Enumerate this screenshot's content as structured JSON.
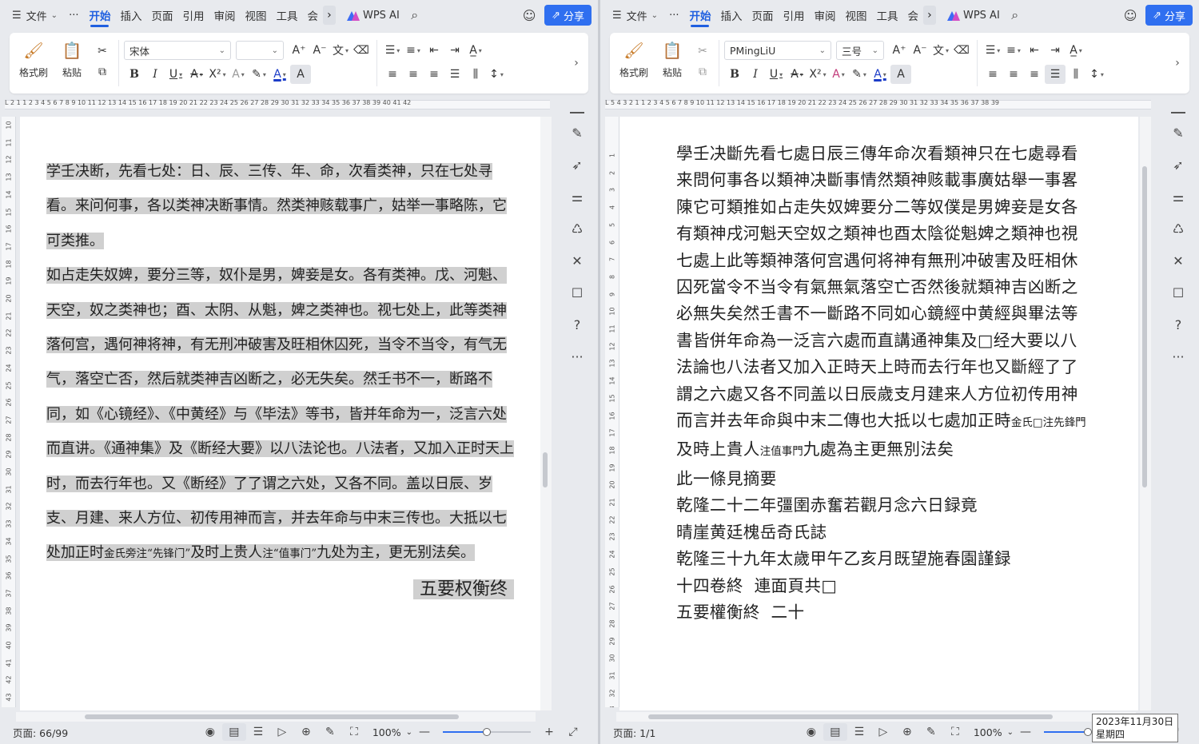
{
  "menubar": {
    "file_label": "文件",
    "more_label": "···",
    "tabs": [
      "开始",
      "插入",
      "页面",
      "引用",
      "审阅",
      "视图",
      "工具",
      "会"
    ],
    "wps_ai": "WPS AI",
    "share": "分享"
  },
  "ribbon_left": {
    "format_painter": "格式刷",
    "paste": "粘贴",
    "font_name": "宋体",
    "font_size": "",
    "buttons": [
      "B",
      "I",
      "U",
      "A",
      "X²",
      "A"
    ]
  },
  "ribbon_right": {
    "format_painter": "格式刷",
    "paste": "粘贴",
    "font_name": "PMingLiU",
    "font_size": "三号"
  },
  "left_ruler": "L  2  1    1  2  3  4  5  6  7  8  9  10  11  12  13  14  15  16  17  18  19  20  21  22  23  24  25  26  27  28  29  30  31  32  33  34  35  36  37  38  39  40  41  42",
  "right_ruler": "L 5  4  3  2  1     1  2  3  4  5  6  7  8  9  10  11  12  13  14  15  16  17  18  19  20  21  22  23  24  25  26  27  28  29  30  31  32  33  34  35  36  37  38  39",
  "left_vruler": [
    "10",
    "11",
    "12",
    "13",
    "14",
    "15",
    "16",
    "17",
    "18",
    "19",
    "20",
    "21",
    "22",
    "23",
    "24",
    "25",
    "26",
    "27",
    "28",
    "29",
    "30",
    "31",
    "32",
    "33",
    "34",
    "35",
    "36",
    "37",
    "38",
    "39",
    "40",
    "41",
    "42",
    "43"
  ],
  "right_vruler": [
    "1",
    "2",
    "3",
    "4",
    "5",
    "6",
    "7",
    "8",
    "9",
    "10",
    "11",
    "12",
    "13",
    "14",
    "15",
    "16",
    "17",
    "18",
    "19",
    "20",
    "21",
    "22",
    "23",
    "24",
    "25",
    "26",
    "27",
    "28",
    "29",
    "30",
    "31",
    "32",
    "33"
  ],
  "left_doc": {
    "para1": "学壬决断，先看七处：日、辰、三传、年、命，次看类神，只在七处寻看。来问何事，各以类神决断事情。然类神赅载事广，姑举一事略陈，它可类推。",
    "para2_main": "如占走失奴婢，要分三等，奴仆是男，婢妾是女。各有类神。戊、河魁、天空，奴之类神也；酉、太阴、从魁，婢之类神也。视七处上，此等类神落何宫，遇何神将神，有无刑冲破害及旺相休囚死，当令不当令，有气无气，落空亡否，然后就类神吉凶断之，必无失矣。然壬书不一，断路不同，如《心镜经》、《中黄经》与《毕法》等书，皆并年命为一，泛言六处而直讲。《通神集》及《断经大要》以八法论也。八法者，又加入正时天上时，而去行年也。又《断经》了了谓之六处，又各不同。盖以日辰、岁支、月建、来人方位、初传用神而言，并去年命与中末三传也。大抵以七处加正时",
    "note1": "金氏旁注“先锋门”",
    "para2_mid": "及时上贵人",
    "note2": "注“值事门”",
    "para2_end": "九处为主，更无别法矣。",
    "ending": "五要权衡终"
  },
  "right_doc": {
    "lines": [
      "學壬决斷先看七處日辰三傳年命次看類神只在七處尋看",
      "来問何事各以類神决斷事情然類神赅載事廣姑舉一事畧",
      "陳它可類推如占走失奴婢要分二等奴僕是男婢妾是女各",
      "有類神戌河魁天空奴之類神也酉太陰從魁婢之類神也視",
      "七處上此等類神落何宫遇何将神有無刑冲破害及旺相休",
      "囚死當令不当令有氣無氣落空亡否然後就類神吉凶断之",
      "必無失矣然壬書不一斷路不同如心鏡經中黄經與畢法等",
      "書皆併年命為一泛言六處而直講通神集及□经大要以八",
      "法論也八法者又加入正時天上時而去行年也又斷經了了",
      "謂之六處又各不同盖以日辰歲支月建来人方位初传用神",
      "而言并去年命與中末二傳也大抵以七處加正時"
    ],
    "line11_note": "金氏□注先鋒門",
    "line12_main": "及時上貴人",
    "line12_note": "注值事門",
    "line12_end": "九處為主更無別法矣",
    "tail": [
      "此一條見摘要",
      "乾隆二十二年彊圉赤奮若觀月念六日録竟",
      "晴崖黄廷槐岳奇氏誌",
      "乾隆三十九年太歲甲午乙亥月既望施春園謹録",
      "十四卷終  連面頁共□",
      "五要權衡終  二十"
    ]
  },
  "statusbar_left": {
    "page": "页面: 66/99",
    "zoom": "100%",
    "zoom_level": 0.5
  },
  "statusbar_right": {
    "page": "页面: 1/1",
    "zoom": "100%",
    "zoom_level": 0.5
  },
  "clock_tooltip": {
    "date": "2023年11月30日",
    "weekday": "星期四"
  },
  "colors": {
    "accent": "#1f5fe0",
    "share_bg": "#2f6ff0",
    "highlight": "#d0d0d0"
  }
}
